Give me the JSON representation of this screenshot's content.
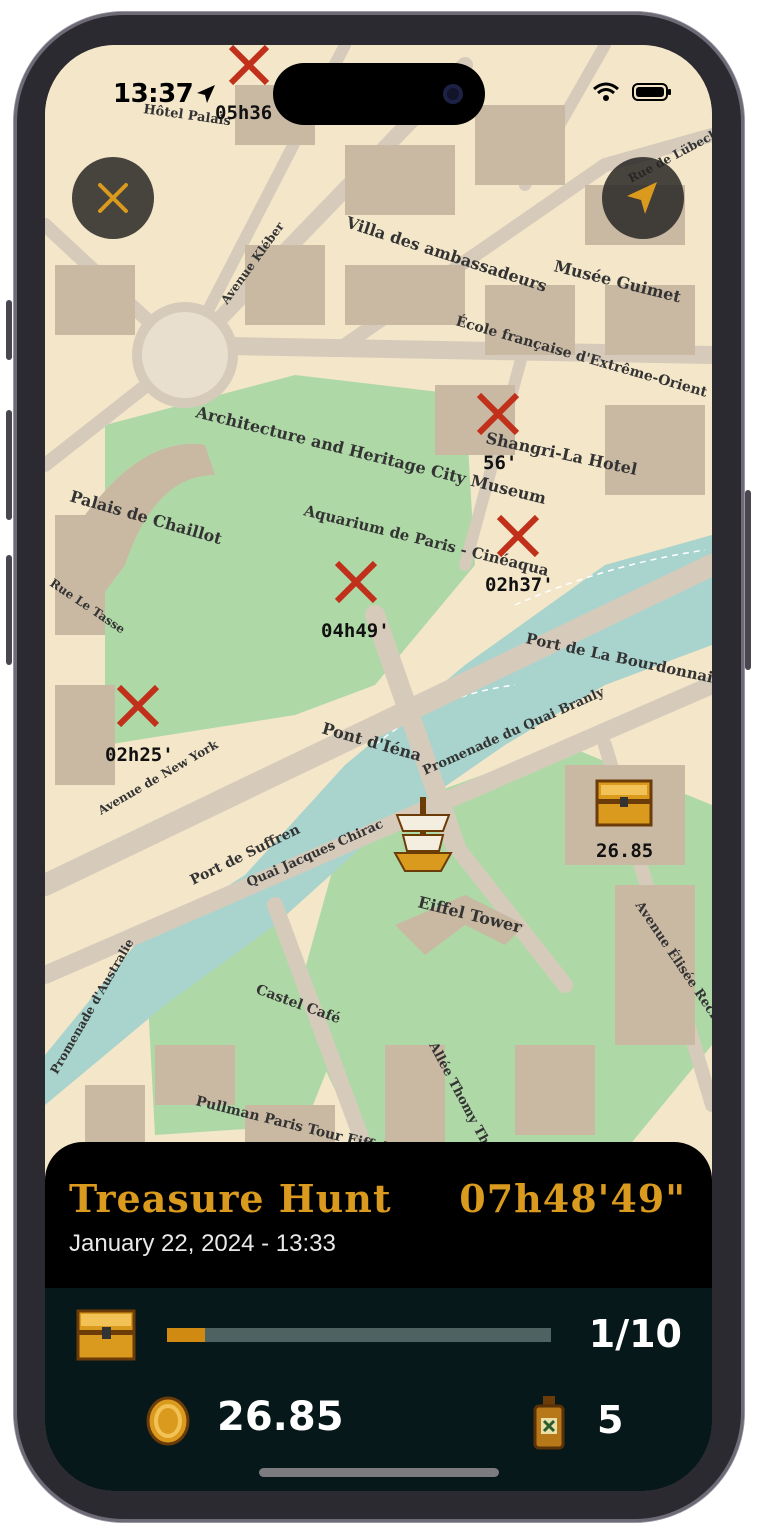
{
  "status_bar": {
    "time": "13:37"
  },
  "map": {
    "places": [
      {
        "name": "Villa des ambassadeurs"
      },
      {
        "name": "Musée Guimet"
      },
      {
        "name": "École française d'Extrême-Orient"
      },
      {
        "name": "Architecture and Heritage City Museum"
      },
      {
        "name": "Shangri-La Hotel"
      },
      {
        "name": "Palais de Chaillot"
      },
      {
        "name": "Aquarium de Paris - Cinéaqua"
      },
      {
        "name": "Port de La Bourdonnais"
      },
      {
        "name": "Pont d'Iéna"
      },
      {
        "name": "Promenade du Quai Branly"
      },
      {
        "name": "Port de Suffren"
      },
      {
        "name": "Quai Jacques Chirac"
      },
      {
        "name": "Eiffel Tower"
      },
      {
        "name": "Castel Café"
      },
      {
        "name": "Promenade d'Australie"
      },
      {
        "name": "Allée Thomy Thierry"
      },
      {
        "name": "Avenue Élisée Reclus"
      },
      {
        "name": "Pullman Paris Tour Eiffel"
      },
      {
        "name": "Avenue de New York"
      },
      {
        "name": "Avenue Kléber"
      },
      {
        "name": "Rue de Lübeck"
      },
      {
        "name": "Rue Le Tasse"
      },
      {
        "name": "Hôtel Palais"
      }
    ],
    "markers": [
      {
        "time": "05h36"
      },
      {
        "time": "56'"
      },
      {
        "time": "02h37'"
      },
      {
        "time": "04h49'"
      },
      {
        "time": "02h25'"
      }
    ],
    "chest_value": "26.85"
  },
  "panel": {
    "title": "Treasure Hunt",
    "timer": "07h48'49\"",
    "date": "January 22, 2024 - 13:33",
    "progress_label": "1/10",
    "progress_fraction": 0.1,
    "coins": "26.85",
    "potions": "5"
  },
  "colors": {
    "accent": "#d99a1e",
    "marker": "#c0301a",
    "water": "#a9d3cd",
    "park": "#afd8a7",
    "land": "#f3e6c9",
    "road": "#d6cbbb",
    "building": "#c9b9a3"
  },
  "icons": {
    "close": "close-icon",
    "locate": "navigation-arrow-icon",
    "chest": "treasure-chest-icon",
    "coin": "gold-coin-icon",
    "potion": "potion-bottle-icon",
    "ship": "pirate-ship-icon"
  }
}
